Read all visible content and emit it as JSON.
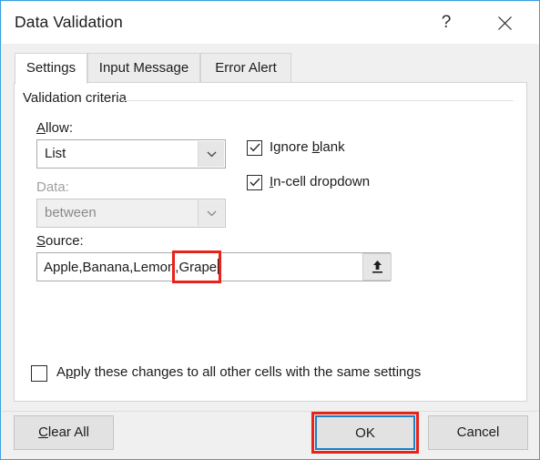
{
  "dialog": {
    "title": "Data Validation",
    "help_icon": "?",
    "close_icon": "close-icon",
    "accent_border": "#3ba1e0",
    "annotation_color": "#e8231a",
    "focus_color": "#1b7fc4"
  },
  "tabs": [
    {
      "label": "Settings",
      "active": true
    },
    {
      "label": "Input Message",
      "active": false
    },
    {
      "label": "Error Alert",
      "active": false
    }
  ],
  "settings": {
    "group_title": "Validation criteria",
    "allow": {
      "label_prefix": "",
      "label_accel": "A",
      "label_rest": "llow:",
      "value": "List",
      "enabled": true,
      "arrow_icon": "chevron-down-icon"
    },
    "data": {
      "label": "Data:",
      "value": "between",
      "enabled": false,
      "arrow_icon": "chevron-down-icon"
    },
    "source": {
      "label_accel": "S",
      "label_rest": "ource:",
      "value": "Apple,Banana,Lemon,Grape",
      "value_before": "Apple,Banana,Lemon,",
      "value_highlighted": "Grape",
      "range_button_icon": "range-select-icon",
      "has_caret": true
    },
    "checkboxes": [
      {
        "name": "ignore-blank",
        "before": "Ignore ",
        "accel": "b",
        "after": "lank",
        "checked": true
      },
      {
        "name": "in-cell-dropdown",
        "before": "",
        "accel": "I",
        "after": "n-cell dropdown",
        "checked": true
      }
    ],
    "apply_all": {
      "before": "A",
      "accel": "p",
      "after": "ply these changes to all other cells with the same settings",
      "checked": false
    }
  },
  "footer": {
    "clear_all": {
      "accel": "C",
      "rest": "lear All"
    },
    "ok": "OK",
    "cancel": "Cancel"
  }
}
